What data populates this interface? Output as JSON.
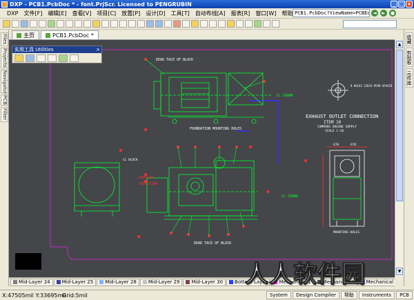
{
  "window": {
    "title": "DXP - PCB1.PcbDoc * - font.PrjScr. Licensed to PENGRUBIN",
    "address": "PCB1.PcbDoc?ViewName=PCBEditor",
    "nav_back": "◄",
    "nav_fwd": "►",
    "nav_go": "●"
  },
  "menu": [
    "DXP",
    "文件[F]",
    "编辑[E]",
    "查看[V]",
    "项目[C]",
    "放置[P]",
    "设计[D]",
    "工具[T]",
    "自动布线[A]",
    "报表[R]",
    "窗口[W]",
    "帮助[H]"
  ],
  "doc_tabs": [
    {
      "label": "主页",
      "active": false
    },
    {
      "label": "PCB1.PcbDoc *",
      "active": true
    }
  ],
  "left_panels": [
    "Files",
    "Projects",
    "Navigator",
    "PCB",
    "Filter"
  ],
  "right_panels": [
    "收藏",
    "剪贴板",
    "元件库"
  ],
  "utilities_panel": {
    "title": "实用工具 Utilities",
    "close": "×"
  },
  "drawing": {
    "note_top_left": "DEAD TACE\nOF BLOCK",
    "note_exhaust_title": "EXHAUST OUTLET CONNECTION",
    "note_item": "ITEM 10",
    "note_cummins": "CUMMINS ENGINE SUPPLY",
    "note_scale": "SCALE 1:10",
    "note_foundation": "FOUNDATION MOUNTING HOLES",
    "note_mounting": "MOUNTING HOLES",
    "note_airflow": "AIRFLOW",
    "note_direction": "DIRECTION",
    "note_dead_bottom": "DEAD TACE\nOF BLOCK",
    "note_cl_crank_top": "CL CRANK",
    "note_cl_crank_mid": "CL CRANK",
    "note_holes": "8 HOLES 22D33-PE9D-SPACED",
    "note_dim1": "670",
    "note_dim2": "670",
    "note_block": "CL BLOCK"
  },
  "layer_tabs": [
    {
      "label": "Mid-Layer 24",
      "color": "#7f7f7f"
    },
    {
      "label": "Mid-Layer 25",
      "color": "#3f3fa0"
    },
    {
      "label": "Mid-Layer 28",
      "color": "#7fb0ff"
    },
    {
      "label": "Mid-Layer 29",
      "color": "#c0c0c0"
    },
    {
      "label": "Mid-Layer 30",
      "color": "#7f3f3f"
    },
    {
      "label": "Bottom Layer",
      "color": "#1f3fff"
    },
    {
      "label": "Mechanical 1",
      "color": "#ff00ff"
    },
    {
      "label": "Mechanical 4",
      "color": "#3f3f3f"
    },
    {
      "label": "Mechanical",
      "color": "#7f7fff"
    }
  ],
  "status": {
    "coords": "X:47505mil Y:33695mil",
    "grid": "Grid:5mil",
    "panels": [
      "System",
      "Design Compiler",
      "帮助",
      "Instruments",
      "PCB"
    ]
  },
  "watermark": "人人软件园",
  "colors": {
    "canvas": "#44464a",
    "drawing_green": "#00ff2a",
    "board_outline": "#c02cc0",
    "route_blue": "#2e2eff",
    "text_white": "#ffffff",
    "dim_red": "#ff3030"
  }
}
